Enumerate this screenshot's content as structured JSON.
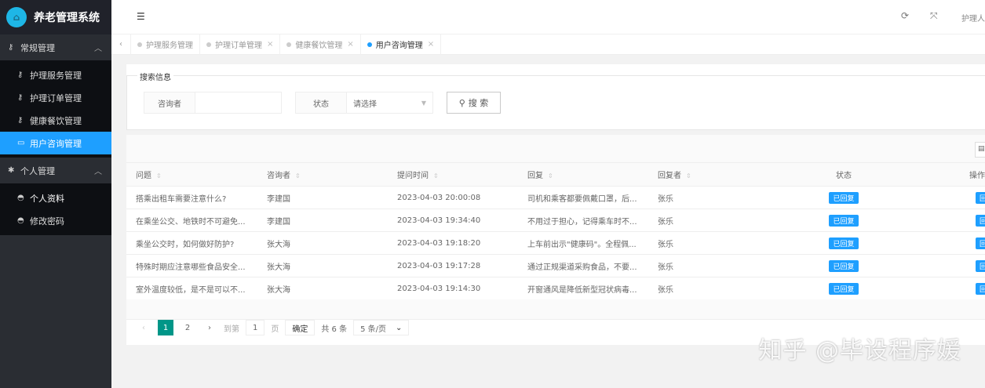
{
  "app_title": "养老管理系统",
  "sidebar": {
    "groups": [
      {
        "label": "常规管理",
        "items": [
          {
            "label": "护理服务管理"
          },
          {
            "label": "护理订单管理"
          },
          {
            "label": "健康餐饮管理"
          },
          {
            "label": "用户咨询管理",
            "active": true
          }
        ]
      },
      {
        "label": "个人管理",
        "items": [
          {
            "label": "个人资料"
          },
          {
            "label": "修改密码"
          }
        ]
      }
    ]
  },
  "header": {
    "user": "护理人"
  },
  "tabs": [
    {
      "label": "护理服务管理"
    },
    {
      "label": "护理订单管理"
    },
    {
      "label": "健康餐饮管理"
    },
    {
      "label": "用户咨询管理"
    }
  ],
  "search": {
    "legend": "搜索信息",
    "consultant_label": "咨询者",
    "consultant_value": "",
    "status_label": "状态",
    "status_placeholder": "请选择",
    "search_button": "搜 索"
  },
  "table": {
    "toolbar_icon": "print-icon",
    "columns": [
      "问题",
      "咨询者",
      "提问时间",
      "回复",
      "回复者",
      "状态",
      "操作"
    ],
    "rows": [
      {
        "q": "搭乘出租车需要注意什么?",
        "user": "李建国",
        "time": "2023-04-03 20:00:08",
        "reply": "司机和乘客都要佩戴口罩，后...",
        "replier": "张乐",
        "status": "已回复",
        "action": "回复"
      },
      {
        "q": "在乘坐公交、地铁时不可避免...",
        "user": "李建国",
        "time": "2023-04-03 19:34:40",
        "reply": "不用过于担心，记得乘车时不...",
        "replier": "张乐",
        "status": "已回复",
        "action": "回复"
      },
      {
        "q": "乘坐公交时，如何做好防护?",
        "user": "张大海",
        "time": "2023-04-03 19:18:20",
        "reply": "上车前出示\"健康码\"。全程佩...",
        "replier": "张乐",
        "status": "已回复",
        "action": "回复"
      },
      {
        "q": "特殊时期应注意哪些食品安全...",
        "user": "张大海",
        "time": "2023-04-03 19:17:28",
        "reply": "通过正规渠道采购食品，不要...",
        "replier": "张乐",
        "status": "已回复",
        "action": "回复"
      },
      {
        "q": "室外温度较低，是不是可以不...",
        "user": "张大海",
        "time": "2023-04-03 19:14:30",
        "reply": "开窗通风是降低新型冠状病毒...",
        "replier": "张乐",
        "status": "已回复",
        "action": "回复"
      }
    ]
  },
  "pagination": {
    "pages": [
      "1",
      "2"
    ],
    "current": "1",
    "goto_label": "到第",
    "goto_value": "1",
    "page_unit": "页",
    "confirm": "确定",
    "total": "共 6 条",
    "page_size": "5 条/页"
  },
  "watermark": "知乎 @毕设程序媛",
  "colors": {
    "accent": "#1e9fff",
    "page_active": "#009688"
  }
}
